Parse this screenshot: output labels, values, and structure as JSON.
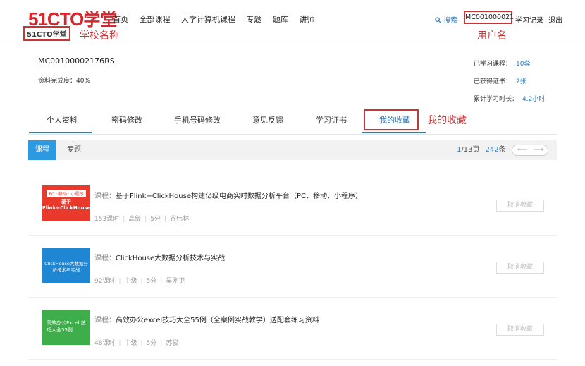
{
  "header": {
    "logo_text": "51CTO",
    "logo_cn": "学堂",
    "logo_sub": "51CTO学堂",
    "anno_school": "学校名称",
    "nav": [
      "首页",
      "全部课程",
      "大学计算机课程",
      "专题",
      "题库",
      "讲师"
    ],
    "search_label": "搜索",
    "username": "MC001000021",
    "anno_user": "用户名",
    "study_record": "学习记录",
    "logout": "退出"
  },
  "profile": {
    "id": "MC00100002176RS",
    "completion": "资料完成度：40%",
    "stats": [
      {
        "label": "已学习课程：",
        "value": "10套"
      },
      {
        "label": "已获得证书：",
        "value": "2张"
      },
      {
        "label": "累计学习时长：",
        "value": "4.2小时"
      }
    ]
  },
  "tabs": [
    "个人资料",
    "密码修改",
    "手机号码修改",
    "意见反馈",
    "学习证书",
    "我的收藏"
  ],
  "anno_fav": "我的收藏",
  "subtabs": {
    "active": "课程",
    "other": "专题",
    "page": "1",
    "page_total": "/13页",
    "count": "242",
    "count_unit": "条"
  },
  "courses": [
    {
      "label": "课程：",
      "title": "基于Flink+ClickHouse构建亿级电商实时数据分析平台（PC、移动、小程序）",
      "hours": "153课时",
      "level": "高级",
      "score": "5分",
      "teacher": "谷伟林",
      "thumb_text": "基于Flink+ClickHouse",
      "thumb_color": "#e8392b",
      "cancel": "取消收藏"
    },
    {
      "label": "课程：",
      "title": "ClickHouse大数据分析技术与实战",
      "hours": "92课时",
      "level": "中级",
      "score": "5分",
      "teacher": "吴刚卫",
      "thumb_text": "ClickHouse大数据分析技术与实战",
      "thumb_color": "#1f86d4",
      "cancel": "取消收藏"
    },
    {
      "label": "课程：",
      "title": "高效办公excel技巧大全55例（全案例实战教学）送配套练习资料",
      "hours": "48课时",
      "level": "中级",
      "score": "5分",
      "teacher": "苏俊",
      "thumb_text": "高效办公Excel 技巧大全55例",
      "thumb_color": "#3dae4a",
      "cancel": "取消收藏"
    }
  ]
}
